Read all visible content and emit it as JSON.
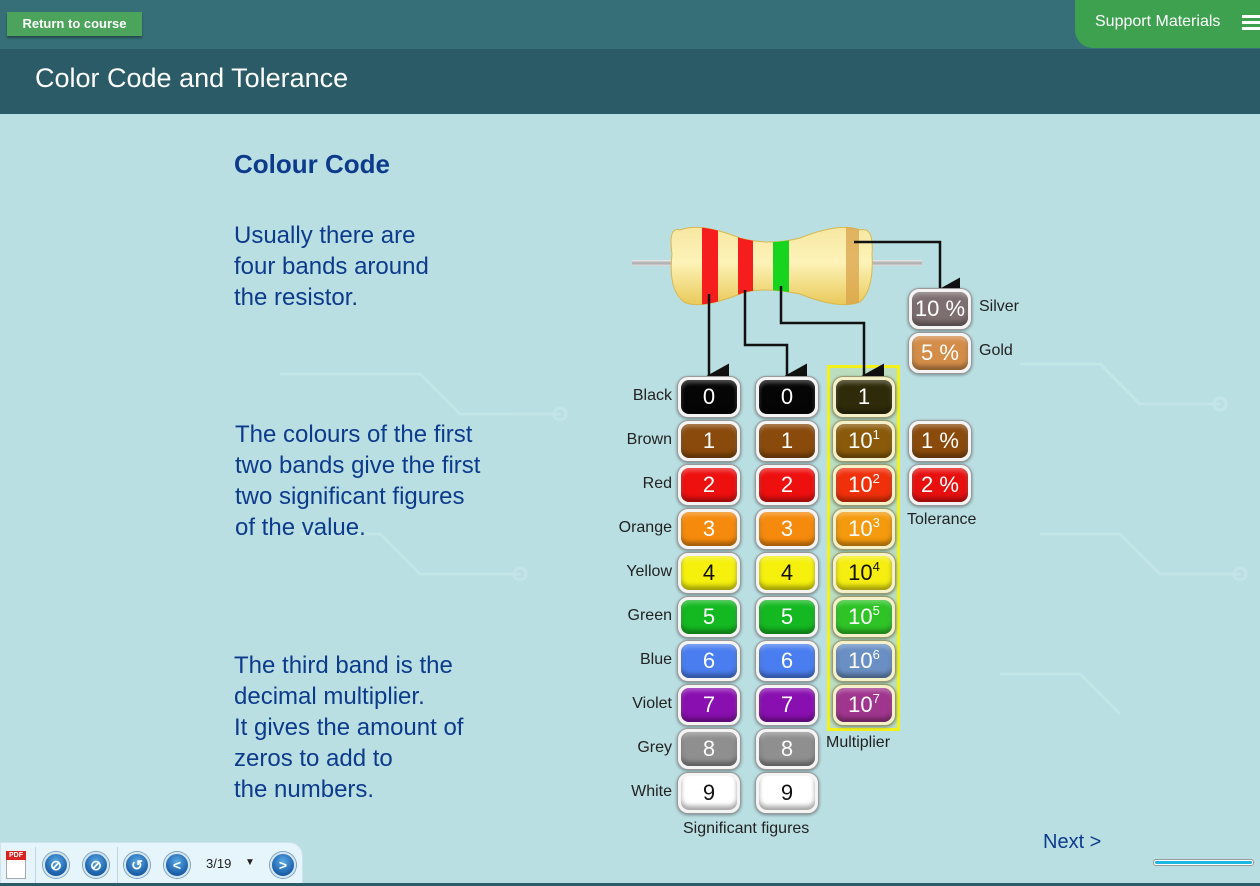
{
  "topbar": {
    "return_label": "Return to course",
    "support_label": "Support Materials",
    "menu_icon": "hamburger-icon"
  },
  "title": "Color Code and Tolerance",
  "colors": {
    "topbar": "#366f77",
    "titlebar": "#2a5b66",
    "accent_green": "#3ea150",
    "text_blue": "#0d3b8c",
    "background": "#badfe2"
  },
  "content": {
    "heading": "Colour Code",
    "para1": [
      "Usually there are",
      "four bands around",
      "the resistor."
    ],
    "para2": [
      "The colours of the first",
      "two bands give the first",
      "two significant figures",
      "of the value."
    ],
    "para3": [
      "The third band is the",
      "decimal multiplier.",
      "It gives the amount of",
      "zeros to add to",
      "the numbers."
    ]
  },
  "resistor": {
    "bands": [
      {
        "name": "band-1",
        "color": "#f51d1d"
      },
      {
        "name": "band-2",
        "color": "#f51d1d"
      },
      {
        "name": "band-3",
        "color": "#17d41f"
      },
      {
        "name": "band-4",
        "color": "#d9a24a"
      }
    ]
  },
  "color_table": {
    "rows": [
      {
        "label": "Black",
        "digit": "0",
        "mult_base": "1",
        "mult_exp": "",
        "color": "#050505",
        "mult_color": "#2f2b0a",
        "text": "#ffffff"
      },
      {
        "label": "Brown",
        "digit": "1",
        "mult_base": "10",
        "mult_exp": "1",
        "color": "#8a4a0c",
        "mult_color": "#8a5a0a",
        "text": "#ffffff"
      },
      {
        "label": "Red",
        "digit": "2",
        "mult_base": "10",
        "mult_exp": "2",
        "color": "#ee0f0f",
        "mult_color": "#f0300a",
        "text": "#ffffff"
      },
      {
        "label": "Orange",
        "digit": "3",
        "mult_base": "10",
        "mult_exp": "3",
        "color": "#f58a0c",
        "mult_color": "#f59a0c",
        "text": "#ffffff"
      },
      {
        "label": "Yellow",
        "digit": "4",
        "mult_base": "10",
        "mult_exp": "4",
        "color": "#f5f00c",
        "mult_color": "#f5ee10",
        "text": "#111111"
      },
      {
        "label": "Green",
        "digit": "5",
        "mult_base": "10",
        "mult_exp": "5",
        "color": "#14b821",
        "mult_color": "#2ec426",
        "text": "#ffffff"
      },
      {
        "label": "Blue",
        "digit": "6",
        "mult_base": "10",
        "mult_exp": "6",
        "color": "#4a7ef0",
        "mult_color": "#6a8fc4",
        "text": "#ffffff"
      },
      {
        "label": "Violet",
        "digit": "7",
        "mult_base": "10",
        "mult_exp": "7",
        "color": "#8a0fb0",
        "mult_color": "#a0358e",
        "text": "#ffffff"
      },
      {
        "label": "Grey",
        "digit": "8",
        "mult_base": "",
        "mult_exp": "",
        "color": "#8f8f8f",
        "mult_color": "",
        "text": "#ffffff"
      },
      {
        "label": "White",
        "digit": "9",
        "mult_base": "",
        "mult_exp": "",
        "color": "#ffffff",
        "mult_color": "",
        "text": "#111111"
      }
    ],
    "sig_label": "Significant figures",
    "mult_label": "Multiplier"
  },
  "tolerance": {
    "top": [
      {
        "value": "10 %",
        "name": "Silver",
        "color": "#7d6e70"
      },
      {
        "value": "5 %",
        "name": "Gold",
        "color": "#d38d49"
      }
    ],
    "side": [
      {
        "value": "1 %",
        "color": "#8a4a0c"
      },
      {
        "value": "2 %",
        "color": "#e8100f"
      }
    ],
    "label": "Tolerance"
  },
  "nav": {
    "next_label": "Next >",
    "progress_fraction": 1.0
  },
  "toolbar": {
    "pdf_tag": "PDF",
    "page_indicator": "3/19",
    "page_dropdown": "▼",
    "prev_glyph": "<",
    "next_glyph": ">",
    "replay_glyph": "↺"
  }
}
